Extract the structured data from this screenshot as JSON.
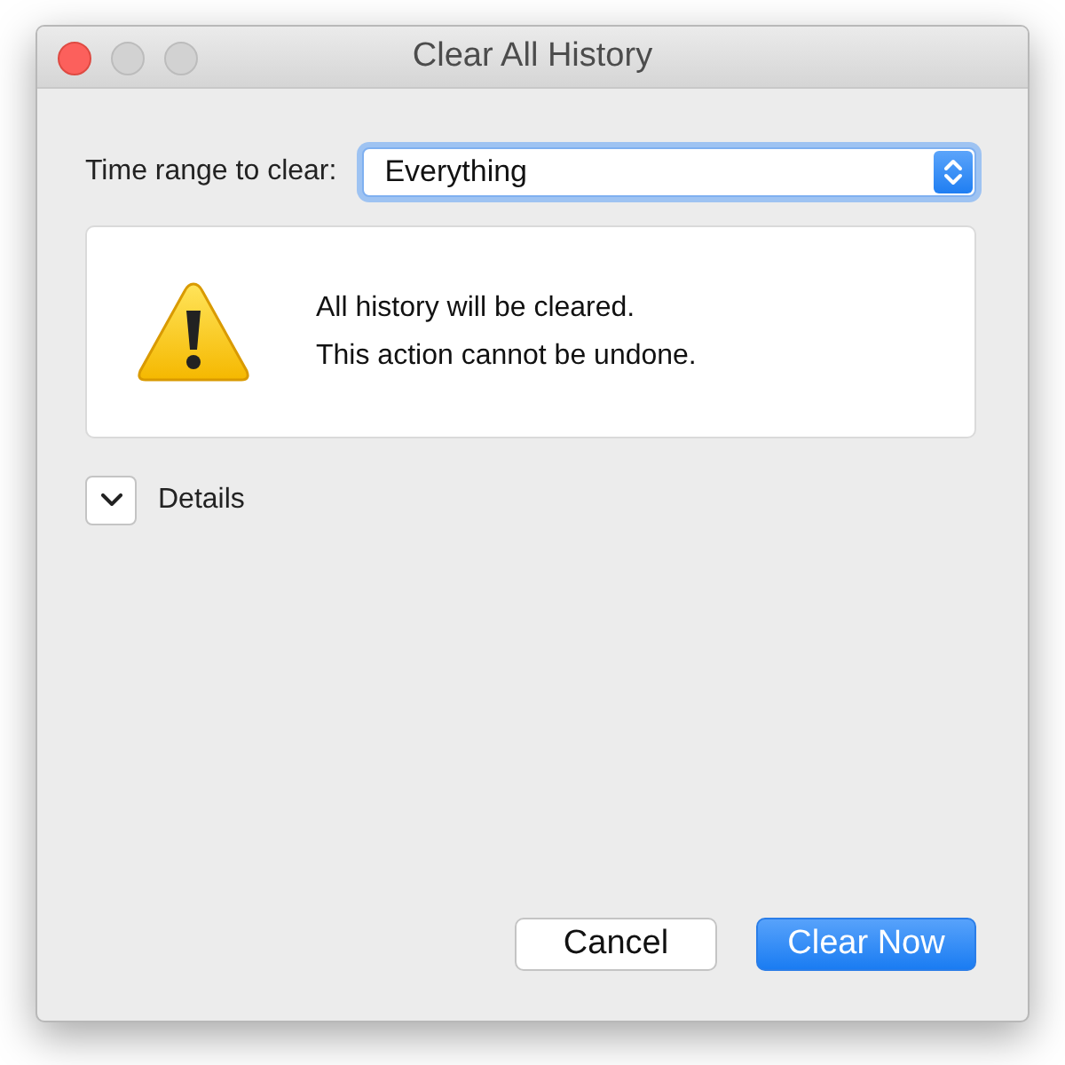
{
  "window": {
    "title": "Clear All History"
  },
  "time_range": {
    "label": "Time range to clear:",
    "value": "Everything"
  },
  "message": {
    "lines": [
      "All history will be cleared.",
      "This action cannot be undone."
    ]
  },
  "details": {
    "label": "Details",
    "expanded": false
  },
  "buttons": [
    {
      "label": "Cancel",
      "kind": "secondary"
    },
    {
      "label": "Clear Now",
      "kind": "primary"
    }
  ]
}
